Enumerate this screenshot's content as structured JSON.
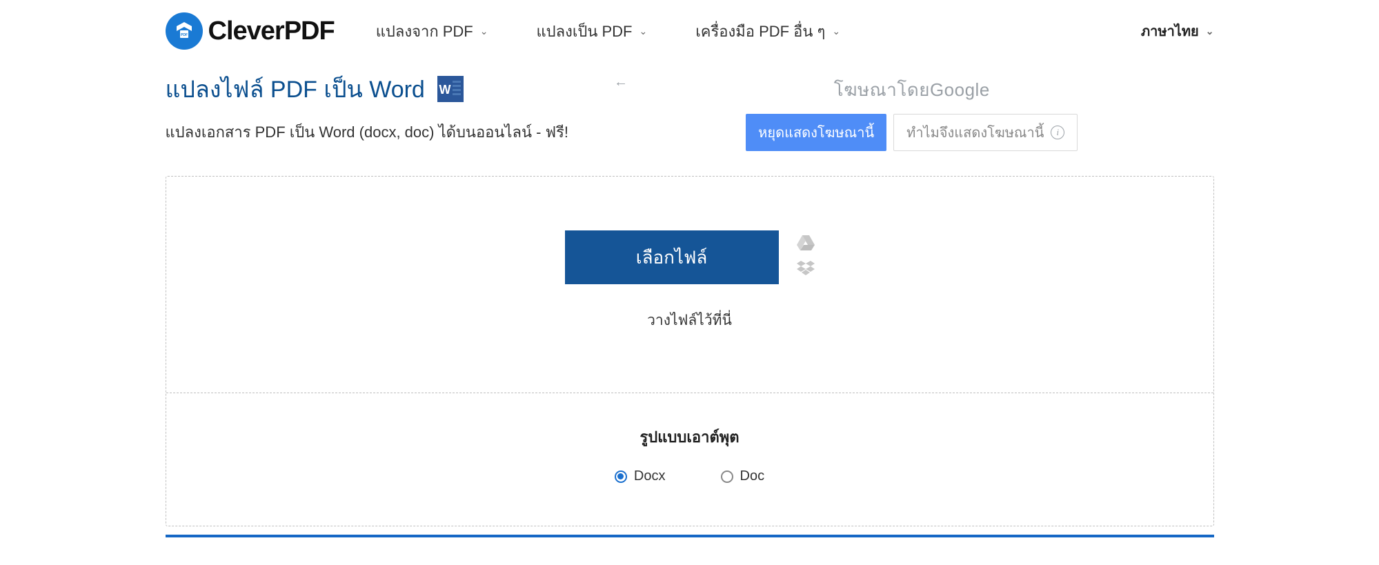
{
  "logo": {
    "text": "CleverPDF"
  },
  "nav": {
    "items": [
      {
        "label": "แปลงจาก PDF"
      },
      {
        "label": "แปลงเป็น PDF"
      },
      {
        "label": "เครื่องมือ PDF อื่น ๆ"
      }
    ]
  },
  "language": {
    "label": "ภาษาไทย"
  },
  "page": {
    "title": "แปลงไฟล์ PDF เป็น Word",
    "subtitle": "แปลงเอกสาร PDF เป็น Word (docx, doc) ได้บนออนไลน์ - ฟรี!"
  },
  "ad": {
    "title_prefix": "โฆษณาโดย",
    "title_brand": "Google",
    "stop_label": "หยุดแสดงโฆษณานี้",
    "why_label": "ทำไมจึงแสดงโฆษณานี้"
  },
  "upload": {
    "choose_label": "เลือกไฟล์",
    "drop_hint": "วางไฟล์ไว้ที่นี่"
  },
  "output": {
    "title": "รูปแบบเอาต์พุต",
    "options": [
      {
        "label": "Docx",
        "checked": true
      },
      {
        "label": "Doc",
        "checked": false
      }
    ]
  }
}
